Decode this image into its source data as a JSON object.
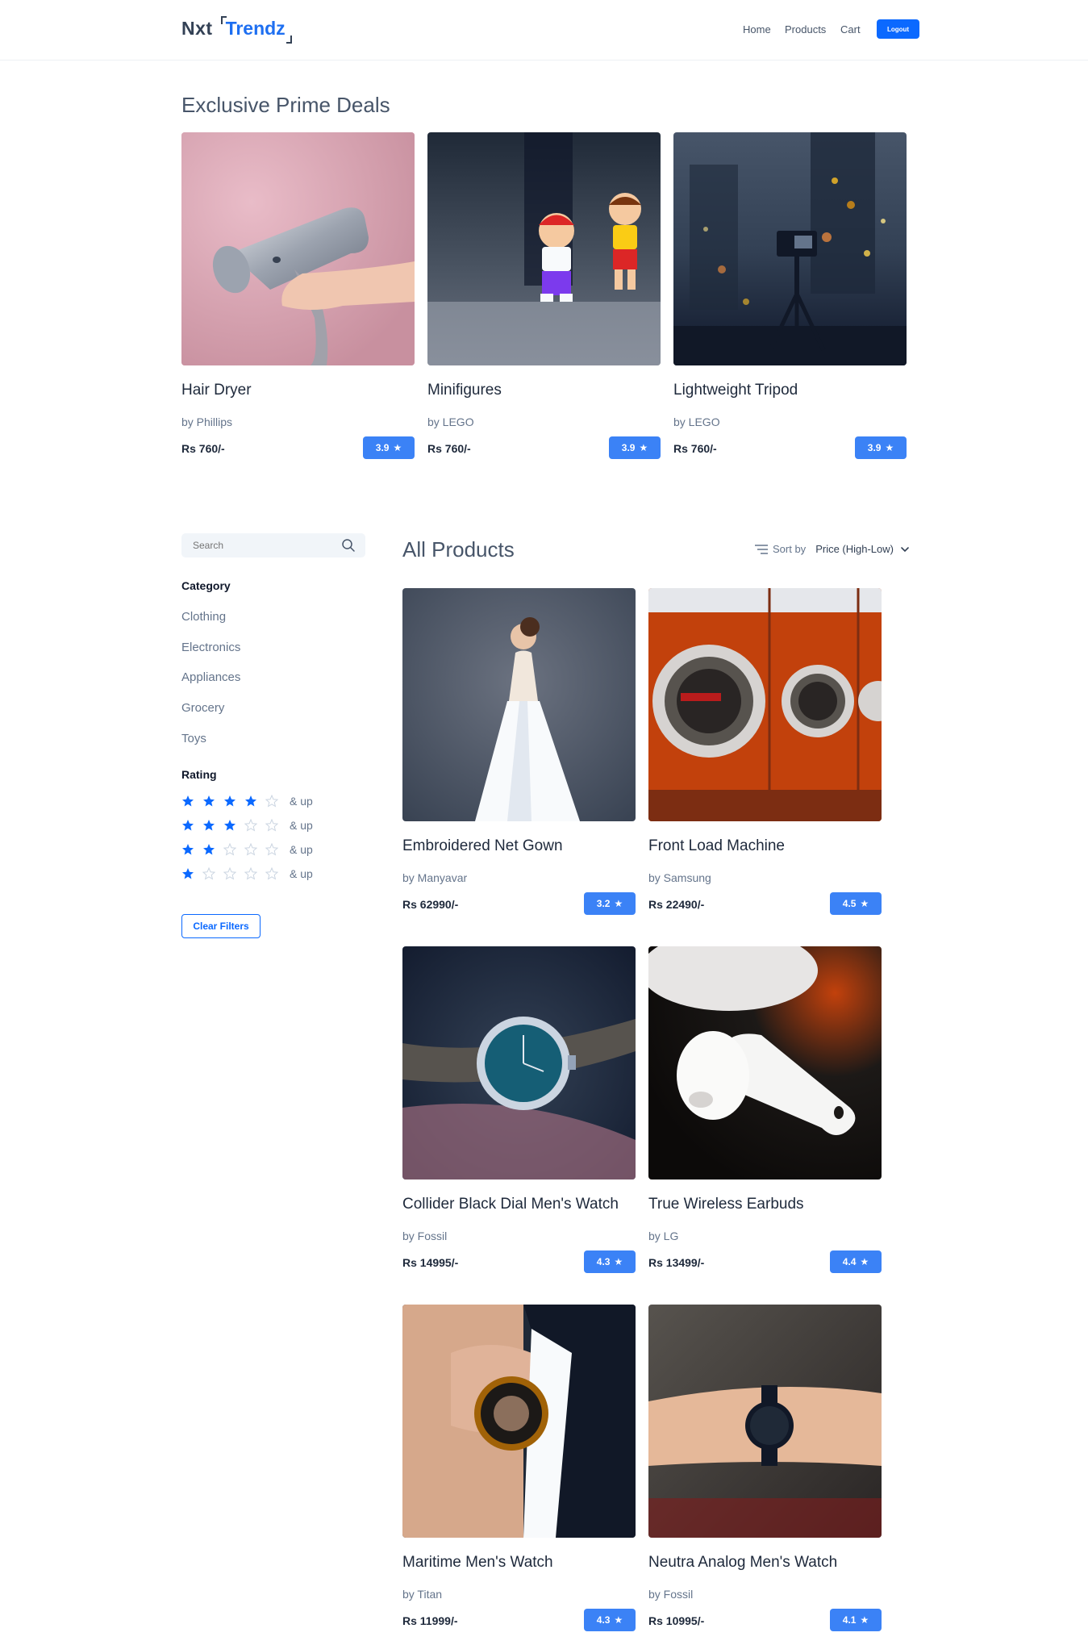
{
  "header": {
    "logo_left": "Nxt",
    "logo_right": "Trendz",
    "nav": {
      "home": "Home",
      "products": "Products",
      "cart": "Cart"
    },
    "logout": "Logout"
  },
  "prime": {
    "title": "Exclusive Prime Deals",
    "items": [
      {
        "title": "Hair Dryer",
        "brand": "by Phillips",
        "price": "Rs 760/-",
        "rating": "3.9"
      },
      {
        "title": "Minifigures",
        "brand": "by LEGO",
        "price": "Rs 760/-",
        "rating": "3.9"
      },
      {
        "title": "Lightweight Tripod",
        "brand": "by LEGO",
        "price": "Rs 760/-",
        "rating": "3.9"
      }
    ]
  },
  "sidebar": {
    "search_placeholder": "Search",
    "category_heading": "Category",
    "categories": [
      "Clothing",
      "Electronics",
      "Appliances",
      "Grocery",
      "Toys"
    ],
    "rating_heading": "Rating",
    "rating_suffix": "& up",
    "ratings": [
      4,
      3,
      2,
      1
    ],
    "clear_filters": "Clear Filters"
  },
  "products": {
    "title": "All Products",
    "sort_label": "Sort by",
    "sort_value": "Price (High-Low)",
    "items": [
      {
        "title": "Embroidered Net Gown",
        "brand": "by Manyavar",
        "price": "Rs 62990/-",
        "rating": "3.2"
      },
      {
        "title": "Front Load Machine",
        "brand": "by Samsung",
        "price": "Rs 22490/-",
        "rating": "4.5"
      },
      {
        "title": "Collider Black Dial Men's Watch",
        "brand": "by Fossil",
        "price": "Rs 14995/-",
        "rating": "4.3"
      },
      {
        "title": "True Wireless Earbuds",
        "brand": "by LG",
        "price": "Rs 13499/-",
        "rating": "4.4"
      },
      {
        "title": "Maritime Men's Watch",
        "brand": "by Titan",
        "price": "Rs 11999/-",
        "rating": "4.3"
      },
      {
        "title": "Neutra Analog Men's Watch",
        "brand": "by Fossil",
        "price": "Rs 10995/-",
        "rating": "4.1"
      }
    ]
  },
  "colors": {
    "brand_blue": "#0b69ff",
    "badge_blue": "#3b82f6",
    "star_filled": "#0b69ff",
    "star_empty": "#cbd5e1"
  }
}
